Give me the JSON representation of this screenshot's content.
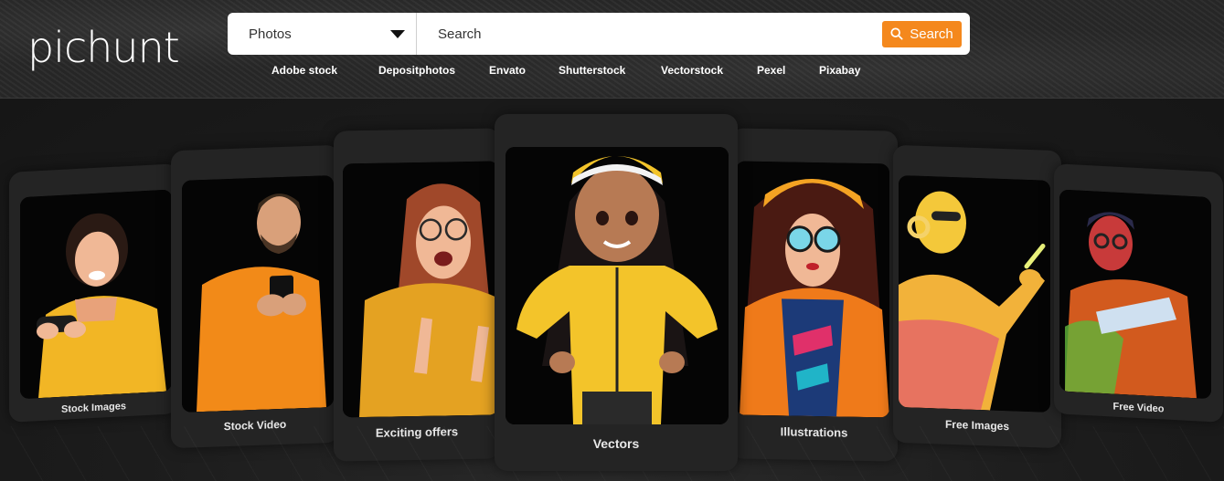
{
  "brand": {
    "logo_text": "pichunt"
  },
  "search": {
    "category_selected": "Photos",
    "placeholder": "Search",
    "button_label": "Search",
    "accent_color": "#f4881d"
  },
  "sources": [
    "Adobe stock",
    "Depositphotos",
    "Envato",
    "Shutterstock",
    "Vectorstock",
    "Pexel",
    "Pixabay"
  ],
  "cards": [
    {
      "label": "Stock Images",
      "subject": "woman-yellow-sweater-gamepad"
    },
    {
      "label": "Stock Video",
      "subject": "man-orange-sweater-phone"
    },
    {
      "label": "Exciting offers",
      "subject": "woman-glasses-pointing"
    },
    {
      "label": "Vectors",
      "subject": "3d-girl-yellow-jacket"
    },
    {
      "label": "Illustrations",
      "subject": "illustrated-woman-sunglasses"
    },
    {
      "label": "Free Images",
      "subject": "neon-woman-headphones"
    },
    {
      "label": "Free Video",
      "subject": "neon-man-tablet"
    }
  ],
  "colors": {
    "header_bg": "#2a2a2a",
    "stage_bg": "#191919",
    "card_bg": "#242424"
  }
}
